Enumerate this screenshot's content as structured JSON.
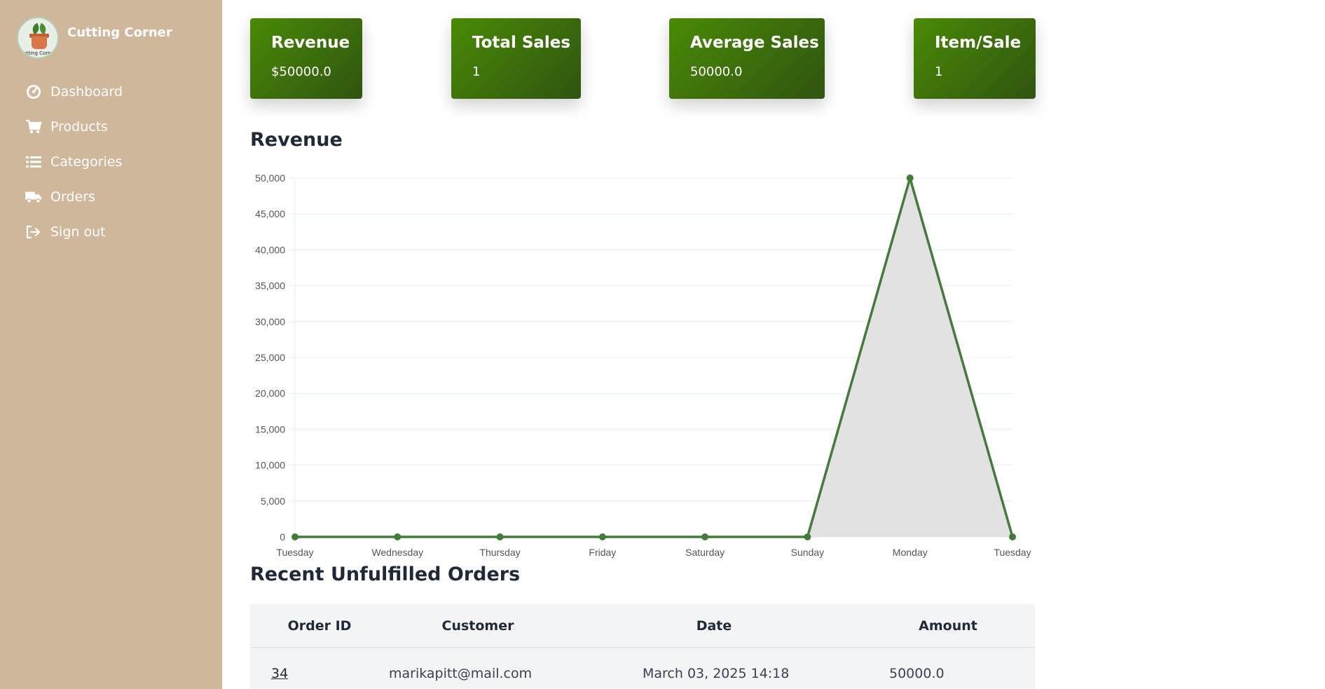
{
  "brand": {
    "name": "Cutting Corner",
    "logo_text": "Cutting Corner"
  },
  "nav": [
    {
      "label": "Dashboard",
      "icon": "gauge-icon"
    },
    {
      "label": "Products",
      "icon": "cart-icon"
    },
    {
      "label": "Categories",
      "icon": "list-icon"
    },
    {
      "label": "Orders",
      "icon": "truck-icon"
    },
    {
      "label": "Sign out",
      "icon": "sign-out-icon"
    }
  ],
  "cards": [
    {
      "title": "Revenue",
      "value": "$50000.0"
    },
    {
      "title": "Total Sales",
      "value": "1"
    },
    {
      "title": "Average Sales",
      "value": "50000.0"
    },
    {
      "title": "Item/Sale",
      "value": "1"
    }
  ],
  "sections": {
    "revenue_title": "Revenue",
    "orders_title": "Recent Unfulfilled Orders"
  },
  "colors": {
    "card_start": "#4a8a06",
    "card_end": "#2f5410",
    "line": "#447a3c",
    "fill": "#e2e2e2",
    "sidebar": "#cfb79b"
  },
  "chart_data": {
    "type": "area",
    "categories": [
      "Tuesday",
      "Wednesday",
      "Thursday",
      "Friday",
      "Saturday",
      "Sunday",
      "Monday",
      "Tuesday"
    ],
    "values": [
      0,
      0,
      0,
      0,
      0,
      0,
      50000,
      0
    ],
    "ylim": [
      0,
      50000
    ],
    "yticks": [
      0,
      5000,
      10000,
      15000,
      20000,
      25000,
      30000,
      35000,
      40000,
      45000,
      50000
    ],
    "ytick_labels": [
      "0",
      "5,000",
      "10,000",
      "15,000",
      "20,000",
      "25,000",
      "30,000",
      "35,000",
      "40,000",
      "45,000",
      "50,000"
    ],
    "grid": true,
    "legend": "none"
  },
  "orders": {
    "columns": [
      "Order ID",
      "Customer",
      "Date",
      "Amount"
    ],
    "rows": [
      {
        "id": "34",
        "customer": "marikapitt@mail.com",
        "date": "March 03, 2025 14:18",
        "amount": "50000.0"
      }
    ]
  }
}
